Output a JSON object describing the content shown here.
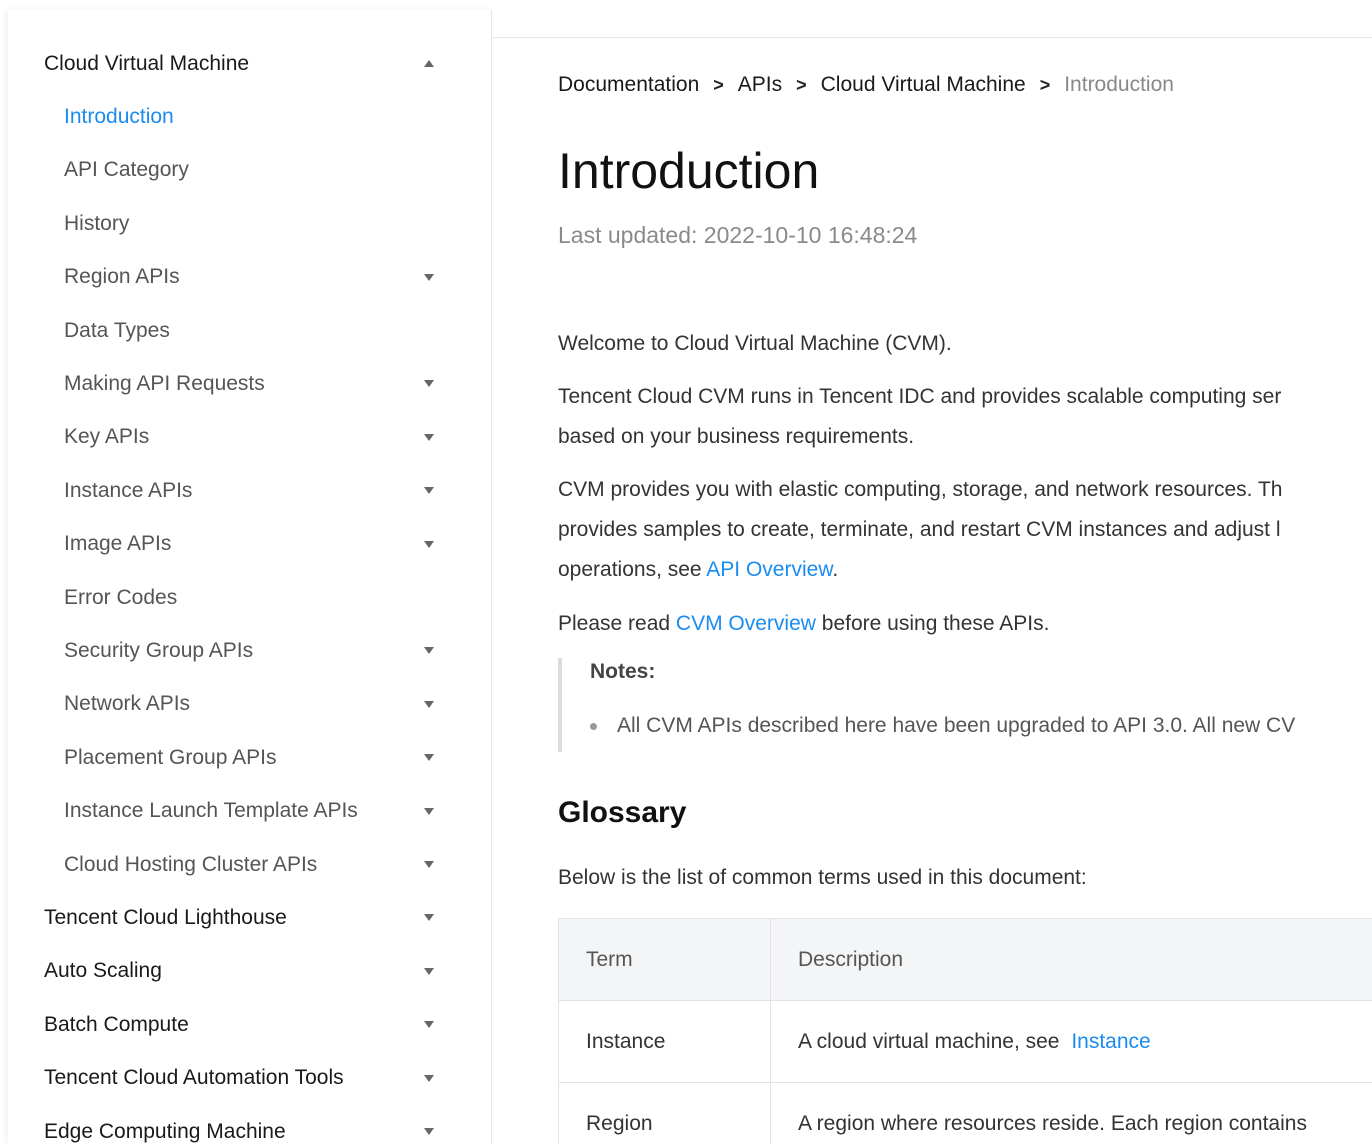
{
  "sidebar": {
    "items": [
      {
        "label": "Cloud Virtual Machine",
        "level": 0,
        "caret": "up",
        "active": false
      },
      {
        "label": "Introduction",
        "level": 1,
        "caret": "",
        "active": true
      },
      {
        "label": "API Category",
        "level": 1,
        "caret": "",
        "active": false
      },
      {
        "label": "History",
        "level": 1,
        "caret": "",
        "active": false
      },
      {
        "label": "Region APIs",
        "level": 1,
        "caret": "down",
        "active": false
      },
      {
        "label": "Data Types",
        "level": 1,
        "caret": "",
        "active": false
      },
      {
        "label": "Making API Requests",
        "level": 1,
        "caret": "down",
        "active": false
      },
      {
        "label": "Key APIs",
        "level": 1,
        "caret": "down",
        "active": false
      },
      {
        "label": "Instance APIs",
        "level": 1,
        "caret": "down",
        "active": false
      },
      {
        "label": "Image APIs",
        "level": 1,
        "caret": "down",
        "active": false
      },
      {
        "label": "Error Codes",
        "level": 1,
        "caret": "",
        "active": false
      },
      {
        "label": "Security Group APIs",
        "level": 1,
        "caret": "down",
        "active": false
      },
      {
        "label": "Network APIs",
        "level": 1,
        "caret": "down",
        "active": false
      },
      {
        "label": "Placement Group APIs",
        "level": 1,
        "caret": "down",
        "active": false
      },
      {
        "label": "Instance Launch Template APIs",
        "level": 1,
        "caret": "down",
        "active": false
      },
      {
        "label": "Cloud Hosting Cluster APIs",
        "level": 1,
        "caret": "down",
        "active": false
      },
      {
        "label": "Tencent Cloud Lighthouse",
        "level": 0,
        "caret": "down",
        "active": false
      },
      {
        "label": "Auto Scaling",
        "level": 0,
        "caret": "down",
        "active": false
      },
      {
        "label": "Batch Compute",
        "level": 0,
        "caret": "down",
        "active": false
      },
      {
        "label": "Tencent Cloud Automation Tools",
        "level": 0,
        "caret": "down",
        "active": false
      },
      {
        "label": "Edge Computing Machine",
        "level": 0,
        "caret": "down",
        "active": false
      }
    ]
  },
  "breadcrumb": {
    "items": [
      "Documentation",
      "APIs",
      "Cloud Virtual Machine",
      "Introduction"
    ],
    "separator": ">"
  },
  "article": {
    "title": "Introduction",
    "last_updated": "Last updated: 2022-10-10 16:48:24",
    "welcome": "Welcome to Cloud Virtual Machine (CVM).",
    "p1_line1": "Tencent Cloud CVM runs in Tencent IDC and provides scalable computing ser",
    "p1_line2": "based on your business requirements.",
    "p2_line1": "CVM provides you with elastic computing, storage, and network resources. Th",
    "p2_line2": "provides samples to create, terminate, and restart CVM instances and adjust l",
    "p2_line3_prefix": "operations, see ",
    "p2_line3_link": "API Overview",
    "p2_line3_suffix": ".",
    "p3_prefix": "Please read ",
    "p3_link": "CVM Overview",
    "p3_suffix": " before using these APIs.",
    "notes_title": "Notes:",
    "notes_item": "All CVM APIs described here have been upgraded to API 3.0. All new CV",
    "glossary_title": "Glossary",
    "glossary_intro": "Below is the list of common terms used in this document:"
  },
  "table": {
    "headers": [
      "Term",
      "Description"
    ],
    "rows": [
      {
        "term": "Instance",
        "desc_prefix": "A cloud virtual machine, see ",
        "desc_link": "Instance"
      },
      {
        "term": "Region",
        "desc_prefix": "A region where resources reside. Each region contains",
        "desc_link": ""
      }
    ]
  },
  "colors": {
    "accent": "#1a8cf0",
    "muted": "#888888",
    "border": "#e3e3e3"
  }
}
